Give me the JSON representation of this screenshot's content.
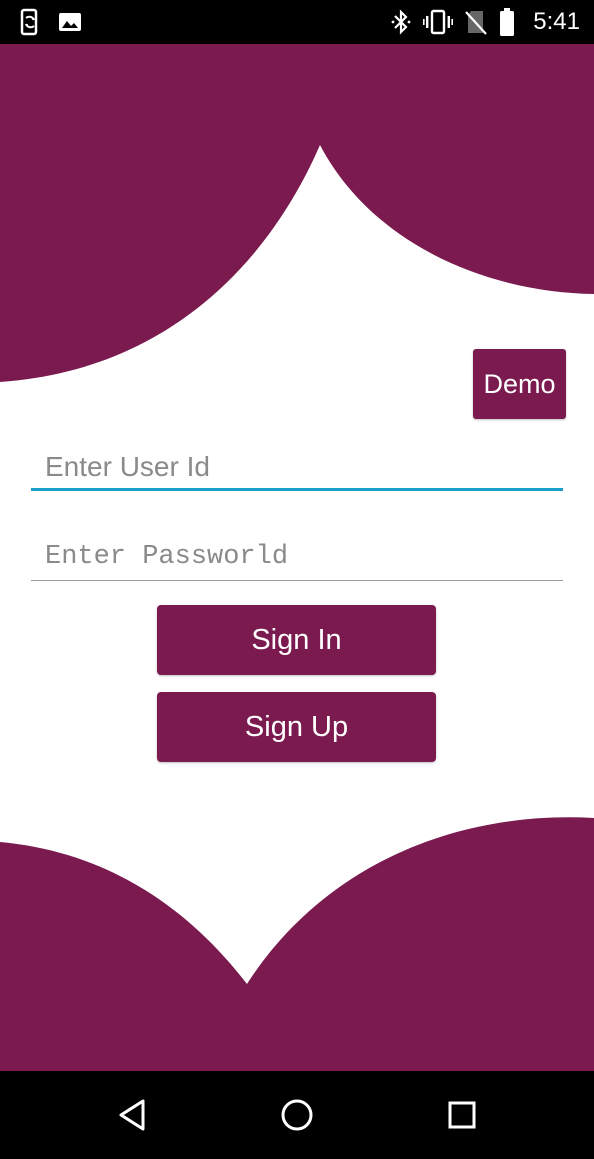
{
  "status_bar": {
    "time": "5:41",
    "left_icons": [
      "sync-phone-icon",
      "image-icon"
    ],
    "right_icons": [
      "bluetooth-icon",
      "vibrate-icon",
      "no-sim-icon",
      "battery-icon"
    ]
  },
  "colors": {
    "brand": "#7b1a4f",
    "input_focus": "#1aa0c8",
    "background": "#ffffff"
  },
  "demo_button": {
    "label": "Demo"
  },
  "login_form": {
    "user_id": {
      "value": "",
      "placeholder": "Enter User Id"
    },
    "password": {
      "value": "",
      "placeholder": "Enter Passworld"
    },
    "sign_in_label": "Sign In",
    "sign_up_label": "Sign Up"
  },
  "nav_bar": {
    "icons": [
      "back-icon",
      "home-icon",
      "recents-icon"
    ]
  }
}
